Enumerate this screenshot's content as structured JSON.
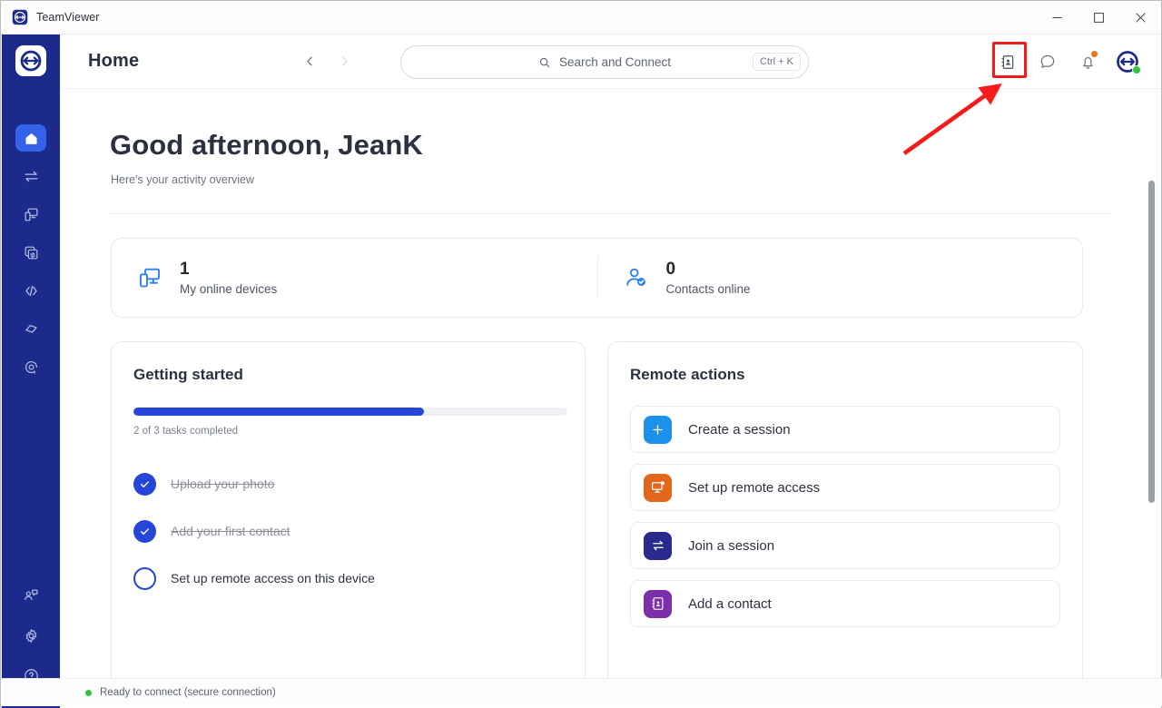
{
  "window": {
    "title": "TeamViewer",
    "logo_icon": "teamviewer-logo-icon",
    "minimize_label": "–",
    "maximize_label": "□",
    "close_label": "×"
  },
  "sidebar": {
    "logo_icon": "teamviewer-logo-icon",
    "items": [
      {
        "name": "home",
        "icon": "home-icon",
        "active": true
      },
      {
        "name": "remote-control",
        "icon": "transfer-arrows-icon",
        "active": false
      },
      {
        "name": "devices",
        "icon": "devices-icon",
        "active": false
      },
      {
        "name": "file-transfer",
        "icon": "file-share-icon",
        "active": false
      },
      {
        "name": "scripts",
        "icon": "code-brackets-icon",
        "active": false
      },
      {
        "name": "augmented-reality",
        "icon": "diamond-tag-icon",
        "active": false
      },
      {
        "name": "monitoring",
        "icon": "monitoring-target-icon",
        "active": false
      }
    ],
    "bottom_items": [
      {
        "name": "contacts-chat",
        "icon": "contacts-chat-icon"
      },
      {
        "name": "settings",
        "icon": "gear-icon"
      },
      {
        "name": "help",
        "icon": "question-circle-icon"
      }
    ]
  },
  "header": {
    "title": "Home",
    "back_icon": "chevron-left-icon",
    "forward_icon": "chevron-right-icon",
    "search": {
      "placeholder": "Search and Connect",
      "value": "",
      "icon": "search-icon",
      "shortcut": "Ctrl + K"
    },
    "icons": [
      {
        "name": "contacts-book-icon",
        "highlighted": true
      },
      {
        "name": "chat-bubble-icon",
        "highlighted": false
      },
      {
        "name": "notification-bell-icon",
        "highlighted": false,
        "badge": true
      }
    ],
    "avatar": {
      "name": "user-avatar",
      "status": "online",
      "status_color": "#37c13b"
    }
  },
  "main": {
    "greeting": "Good afternoon, JeanK",
    "subtitle": "Here's your activity overview",
    "stats": [
      {
        "value": "1",
        "label": "My online devices",
        "icon": "devices-icon",
        "color": "#2d7ff0"
      },
      {
        "value": "0",
        "label": "Contacts online",
        "icon": "contact-check-icon",
        "color": "#2d7ff0"
      }
    ],
    "getting_started": {
      "title": "Getting started",
      "progress_percent": 67,
      "progress_label": "2 of 3 tasks completed",
      "tasks": [
        {
          "label": "Upload your photo",
          "completed": true
        },
        {
          "label": "Add your first contact",
          "completed": true
        },
        {
          "label": "Set up remote access on this device",
          "completed": false
        }
      ]
    },
    "remote_actions": {
      "title": "Remote actions",
      "items": [
        {
          "label": "Create a session",
          "icon": "plus-icon",
          "color": "#1c91eb"
        },
        {
          "label": "Set up remote access",
          "icon": "monitor-access-icon",
          "color": "#e2671a"
        },
        {
          "label": "Join a session",
          "icon": "transfer-arrows-icon",
          "color": "#2a2a8e"
        },
        {
          "label": "Add a contact",
          "icon": "contacts-book-icon",
          "color": "#7b2fa8"
        }
      ]
    }
  },
  "statusbar": {
    "text": "Ready to connect (secure connection)",
    "dot_color": "#37c13b"
  },
  "annotation": {
    "color": "#f61a1a",
    "target": "contacts-book-icon"
  }
}
